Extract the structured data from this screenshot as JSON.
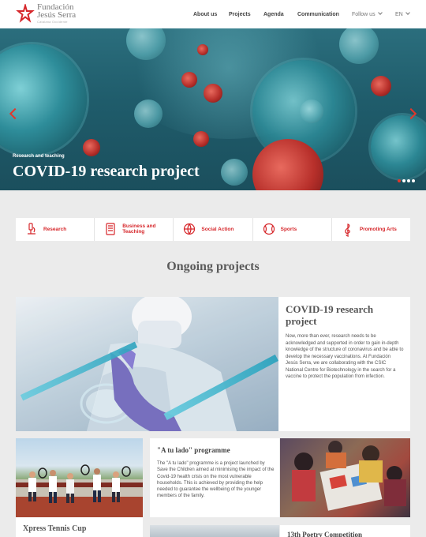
{
  "brand": {
    "line1": "Fundación",
    "line2": "Jesús Serra",
    "tagline": "Catalana Occidente",
    "accent": "#d6262a"
  },
  "nav": {
    "items": [
      "About us",
      "Projects",
      "Agenda",
      "Communication"
    ],
    "follow": "Follow us",
    "lang": "EN"
  },
  "hero": {
    "eyebrow": "Research and teaching",
    "title": "COVID-19 research project",
    "slide_count": 4,
    "active_slide": 1,
    "prev_icon": "chevron-left-icon",
    "next_icon": "chevron-right-icon"
  },
  "categories": [
    {
      "label": "Research",
      "icon": "microscope-icon"
    },
    {
      "label": "Business and Teaching",
      "icon": "book-icon"
    },
    {
      "label": "Social Action",
      "icon": "globe-icon"
    },
    {
      "label": "Sports",
      "icon": "ball-icon"
    },
    {
      "label": "Promoting Arts",
      "icon": "treble-clef-icon"
    }
  ],
  "section_title": "Ongoing projects",
  "featured": {
    "title": "COVID-19 research project",
    "body": "Now, more than ever, research needs to be acknowledged and supported in order to gain in-depth knowledge of the structure of coronavirus and be able to develop the necessary vaccinations. At Fundación Jesús Serra, we are collaborating with the CSIC National Centre for Biotechnology in the search for a vaccine to protect the population from infection."
  },
  "cards": {
    "tennis": {
      "title": "Xpress Tennis Cup"
    },
    "atulado": {
      "title": "\"A tu lado\" programme",
      "body": "The \"A tu lado\" programme is a project launched by Save the Children aimed at minimising the impact of the Covid-19 health crisis on the most vulnerable households. This is achieved by providing the help needed to guarantee the wellbeing of the younger members of the family."
    },
    "poetry": {
      "title": "13th Poetry Competition"
    }
  }
}
